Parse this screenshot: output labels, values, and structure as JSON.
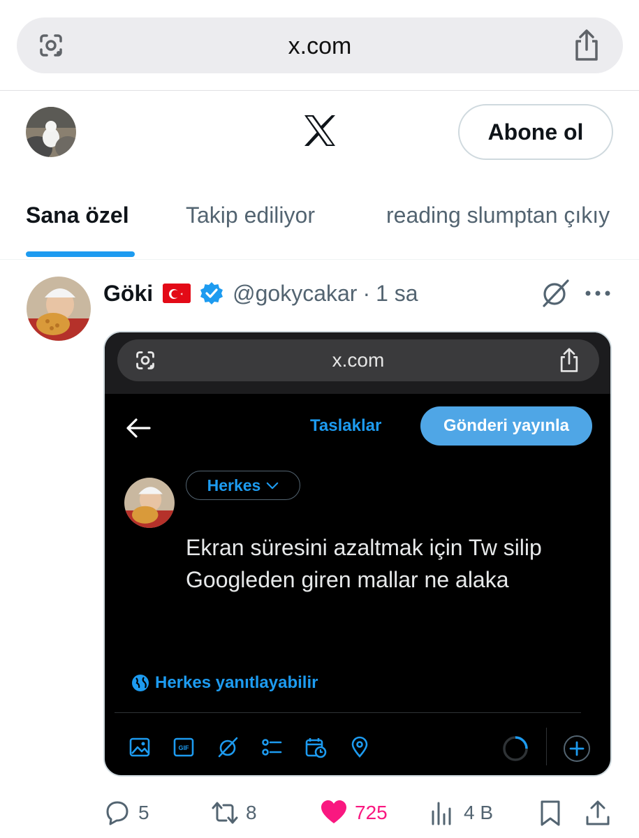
{
  "browser": {
    "url": "x.com"
  },
  "header": {
    "subscribe_label": "Abone ol"
  },
  "tabs": [
    {
      "label": "Sana özel",
      "active": true
    },
    {
      "label": "Takip ediliyor",
      "active": false
    },
    {
      "label": "reading slumptan çıkıy",
      "active": false
    }
  ],
  "tweet": {
    "author_name": "Göki",
    "handle": "@gokycakar",
    "separator": "·",
    "time": "1 sa",
    "media": {
      "url": "x.com",
      "drafts_label": "Taslaklar",
      "post_label": "Gönderi yayınla",
      "audience_label": "Herkes",
      "post_text_line1": "Ekran süresini azaltmak için Tw silip",
      "post_text_line2": "Googleden giren mallar ne alaka",
      "reply_setting": "Herkes yanıtlayabilir"
    },
    "stats": {
      "replies": "5",
      "reposts": "8",
      "likes": "725",
      "views": "4 B"
    }
  },
  "colors": {
    "accent": "#1d9bf0",
    "like": "#f91880",
    "text_primary": "#0f1419",
    "text_secondary": "#536471"
  }
}
